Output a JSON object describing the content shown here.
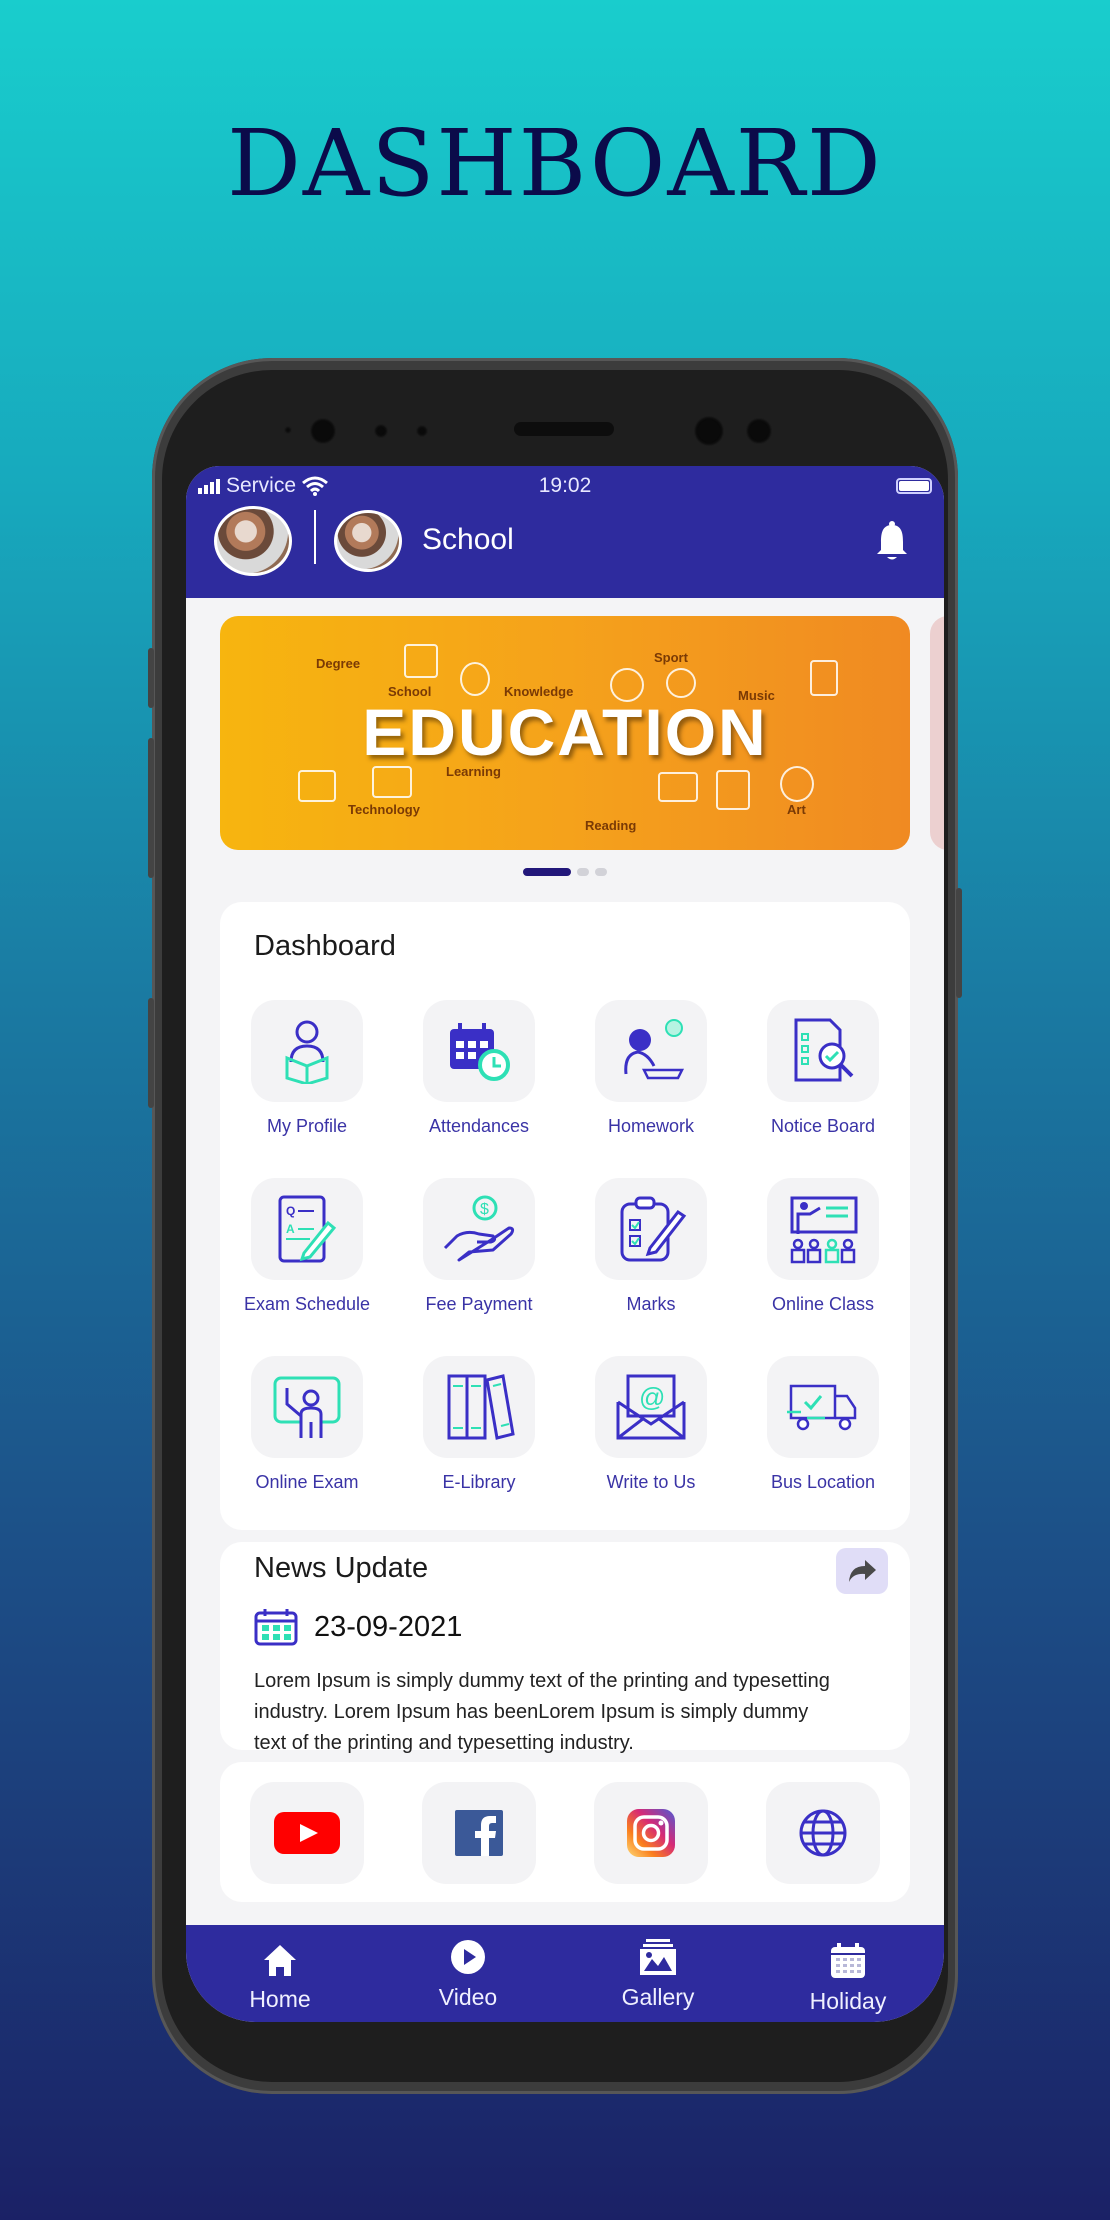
{
  "page": {
    "title": "DASHBOARD"
  },
  "status_bar": {
    "carrier": "Service",
    "time": "19:02"
  },
  "header": {
    "school_name": "School"
  },
  "banner": {
    "title": "EDUCATION",
    "words": [
      "Degree",
      "School",
      "Knowledge",
      "Sport",
      "Music",
      "Learning",
      "Technology",
      "Reading",
      "Art"
    ],
    "slide_count": 3,
    "active_slide": 1
  },
  "dashboard": {
    "title": "Dashboard",
    "items": [
      {
        "label": "My Profile",
        "icon": "student-reading-icon"
      },
      {
        "label": "Attendances",
        "icon": "calendar-clock-icon"
      },
      {
        "label": "Homework",
        "icon": "student-writing-icon"
      },
      {
        "label": "Notice Board",
        "icon": "document-search-icon"
      },
      {
        "label": "Exam Schedule",
        "icon": "exam-paper-icon"
      },
      {
        "label": "Fee Payment",
        "icon": "hand-dollar-icon"
      },
      {
        "label": "Marks",
        "icon": "clipboard-check-icon"
      },
      {
        "label": "Online Class",
        "icon": "teacher-board-icon"
      },
      {
        "label": "Online Exam",
        "icon": "teacher-screen-icon"
      },
      {
        "label": "E-Library",
        "icon": "books-icon"
      },
      {
        "label": "Write to Us",
        "icon": "email-icon"
      },
      {
        "label": "Bus Location",
        "icon": "delivery-truck-icon"
      }
    ]
  },
  "news": {
    "title": "News Update",
    "date": "23-09-2021",
    "text": "Lorem Ipsum is simply dummy text of the printing and typesetting industry. Lorem Ipsum has beenLorem Ipsum is simply dummy text of the printing and typesetting industry."
  },
  "social": [
    {
      "name": "YouTube",
      "icon": "youtube-icon",
      "color": "#ff0000"
    },
    {
      "name": "Facebook",
      "icon": "facebook-icon",
      "color": "#3b5998"
    },
    {
      "name": "Instagram",
      "icon": "instagram-icon",
      "color": "#d62976"
    },
    {
      "name": "Website",
      "icon": "globe-icon",
      "color": "#3a2fc6"
    }
  ],
  "bottom_nav": [
    {
      "label": "Home",
      "icon": "home-icon"
    },
    {
      "label": "Video",
      "icon": "play-circle-icon"
    },
    {
      "label": "Gallery",
      "icon": "gallery-icon"
    },
    {
      "label": "Holiday",
      "icon": "calendar-icon"
    }
  ],
  "colors": {
    "primary": "#2e2b9e",
    "accent": "#2ee0b5",
    "icon_stroke": "#3a2fc6",
    "banner": "#f5a21b"
  }
}
